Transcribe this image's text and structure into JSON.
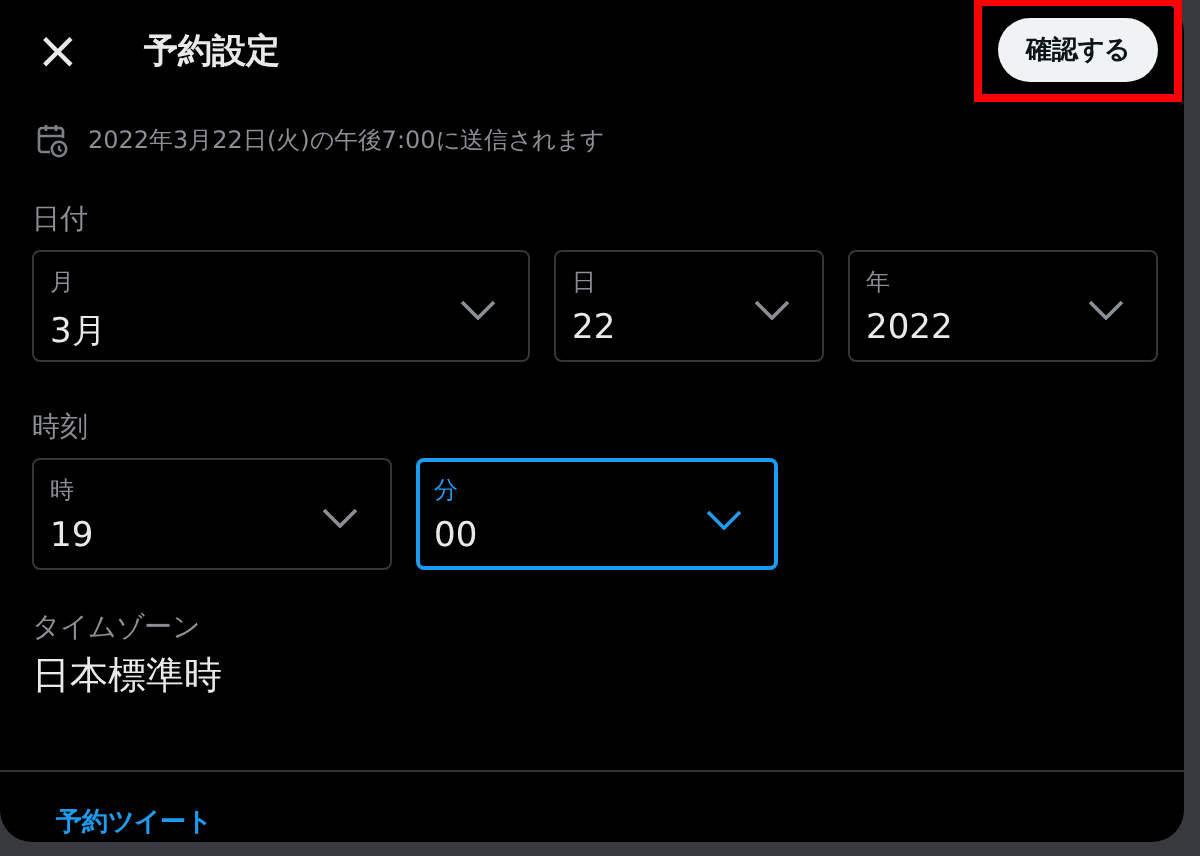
{
  "header": {
    "close": "×",
    "title": "予約設定",
    "confirm": {
      "label": "確認する",
      "highlighted": true
    }
  },
  "notice": "2022年3月22日(火)の午後7:00に送信されます",
  "date": {
    "label": "日付",
    "fields": [
      {
        "label": "月",
        "value": "3月",
        "focused": false
      },
      {
        "label": "日",
        "value": "22",
        "focused": false
      },
      {
        "label": "年",
        "value": "2022",
        "focused": false
      }
    ]
  },
  "time": {
    "label": "時刻",
    "fields": [
      {
        "label": "時",
        "value": "19",
        "focused": false
      },
      {
        "label": "分",
        "value": "00",
        "focused": true
      }
    ]
  },
  "timezone": {
    "label": "タイムゾーン",
    "value": "日本標準時"
  },
  "footer_link": "予約ツイート"
}
